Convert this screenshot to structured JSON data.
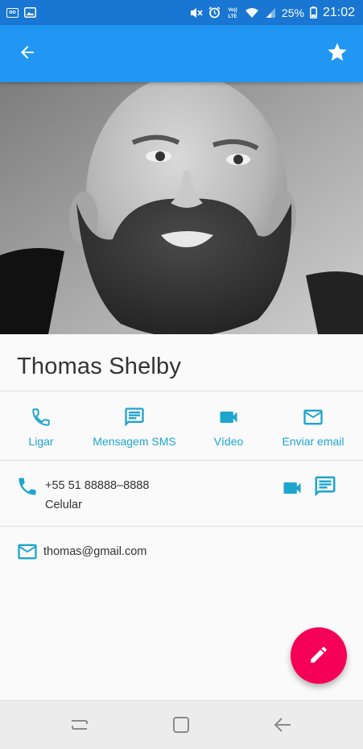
{
  "status_bar": {
    "battery": "25%",
    "time": "21:02",
    "left_icons": [
      "notification-icon",
      "image-icon"
    ],
    "right_icons": [
      "mute-icon",
      "alarm-icon",
      "volte-icon",
      "wifi-icon",
      "signal-icon",
      "battery-icon"
    ],
    "volte_label": "Vol) LTE"
  },
  "app_bar": {
    "back_icon": "arrow-back-icon",
    "favorite_icon": "star-icon",
    "color": "#2196f3"
  },
  "contact": {
    "name": "Thomas Shelby",
    "photo": "contact-photo"
  },
  "actions": [
    {
      "label": "Ligar",
      "icon": "phone-icon"
    },
    {
      "label": "Mensagem SMS",
      "icon": "message-icon"
    },
    {
      "label": "Vídeo",
      "icon": "videocam-icon"
    },
    {
      "label": "Enviar email",
      "icon": "email-icon"
    }
  ],
  "phone": {
    "number": "+55 51 88888–8888",
    "type": "Celular"
  },
  "email": {
    "address": "thomas@gmail.com"
  },
  "fab": {
    "icon": "edit-icon",
    "color": "#f50057"
  },
  "accent_color": "#1ea5cf",
  "nav_bar": {
    "icons": [
      "recent-apps-icon",
      "home-icon",
      "back-icon"
    ]
  }
}
